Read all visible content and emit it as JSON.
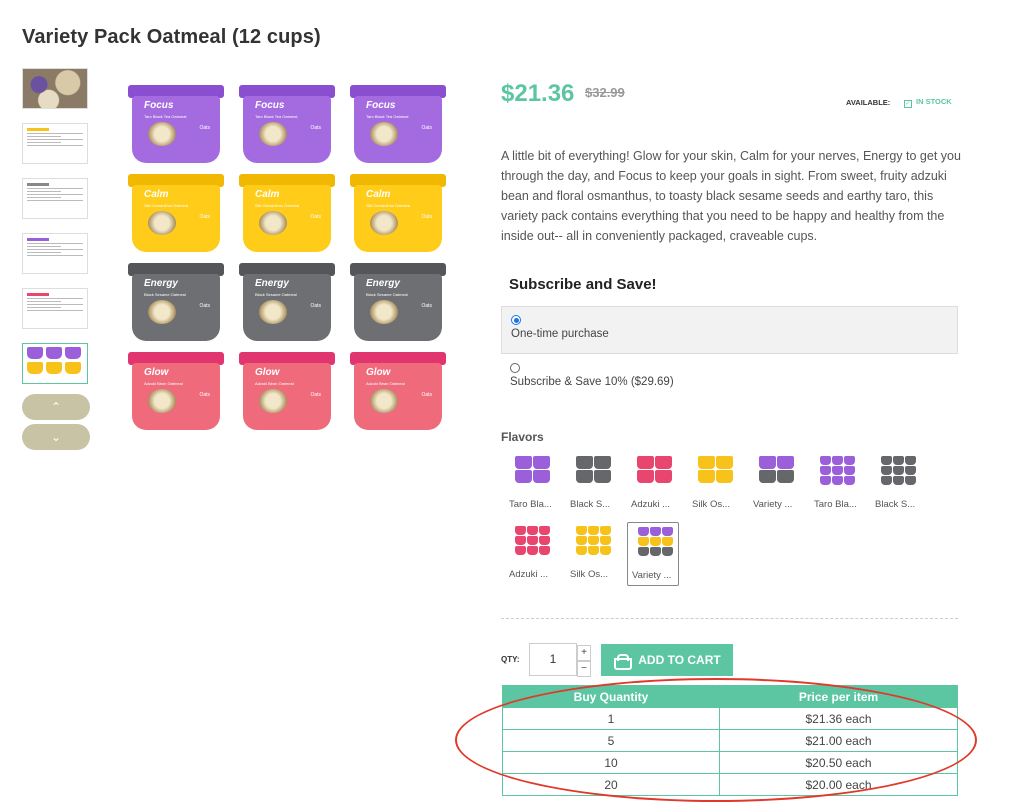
{
  "product": {
    "title": "Variety Pack Oatmeal (12 cups)",
    "price": "$21.36",
    "old_price": "$32.99",
    "available_label": "AVAILABLE:",
    "stock_status": "IN STOCK",
    "description": "A little bit of everything! Glow for your skin, Calm for your nerves, Energy to get you through the day, and Focus to keep your goals in sight. From sweet, fruity adzuki bean and floral osmanthus, to toasty black sesame seeds and earthy taro, this variety pack contains everything that you need to be happy and healthy from the inside out-- all in conveniently packaged, craveable cups."
  },
  "gallery": {
    "cup_rows": [
      {
        "name": "Focus",
        "subtitle": "Taro Black Tea Oatmeal",
        "lid": "#8a4fd0",
        "body": "#a46be0"
      },
      {
        "name": "Calm",
        "subtitle": "Silk Osmanthus Oatmeal",
        "lid": "#f0b800",
        "body": "#ffcc1a"
      },
      {
        "name": "Energy",
        "subtitle": "Black Sesame Oatmeal",
        "lid": "#55565a",
        "body": "#6e6f73"
      },
      {
        "name": "Glow",
        "subtitle": "Adzuki Bean Oatmeal",
        "lid": "#e0356f",
        "body": "#ef6b7c"
      }
    ],
    "cup_claim": "Oats"
  },
  "subscribe": {
    "title": "Subscribe and Save!",
    "options": [
      {
        "label": "One-time purchase",
        "selected": true
      },
      {
        "label": "Subscribe & Save 10% ($29.69)",
        "selected": false
      }
    ]
  },
  "flavors": {
    "label": "Flavors",
    "items": [
      {
        "label": "Taro Bla...",
        "colors": [
          "#9b5fd9"
        ],
        "grid": 2
      },
      {
        "label": "Black S...",
        "colors": [
          "#66676b"
        ],
        "grid": 2
      },
      {
        "label": "Adzuki ...",
        "colors": [
          "#e8456f"
        ],
        "grid": 2
      },
      {
        "label": "Silk Os...",
        "colors": [
          "#f7c21a"
        ],
        "grid": 2
      },
      {
        "label": "Variety ...",
        "colors": [
          "#9b5fd9",
          "#66676b",
          "#f7c21a",
          "#66676b"
        ],
        "grid": 2
      },
      {
        "label": "Taro Bla...",
        "colors": [
          "#9b5fd9"
        ],
        "grid": 3
      },
      {
        "label": "Black S...",
        "colors": [
          "#66676b"
        ],
        "grid": 3
      },
      {
        "label": "Adzuki ...",
        "colors": [
          "#e8456f"
        ],
        "grid": 3
      },
      {
        "label": "Silk Os...",
        "colors": [
          "#f7c21a"
        ],
        "grid": 3
      },
      {
        "label": "Variety ...",
        "colors": [
          "#9b5fd9",
          "#f7c21a",
          "#66676b",
          "#e8456f"
        ],
        "grid": 3,
        "selected": true
      }
    ]
  },
  "cart": {
    "qty_label": "QTY:",
    "qty_value": "1",
    "plus": "+",
    "minus": "−",
    "add_to_cart": "ADD TO CART"
  },
  "tiers": {
    "headers": [
      "Buy Quantity",
      "Price per item"
    ],
    "rows": [
      [
        "1",
        "$21.36 each"
      ],
      [
        "5",
        "$21.00 each"
      ],
      [
        "10",
        "$20.50 each"
      ],
      [
        "20",
        "$20.00 each"
      ]
    ]
  },
  "thumb_nav": {
    "up": "⌃",
    "down": "⌄"
  },
  "colors": {
    "accent": "#5cc6a3",
    "annotation": "#e0392b",
    "nav_button": "#c9c3a6"
  }
}
